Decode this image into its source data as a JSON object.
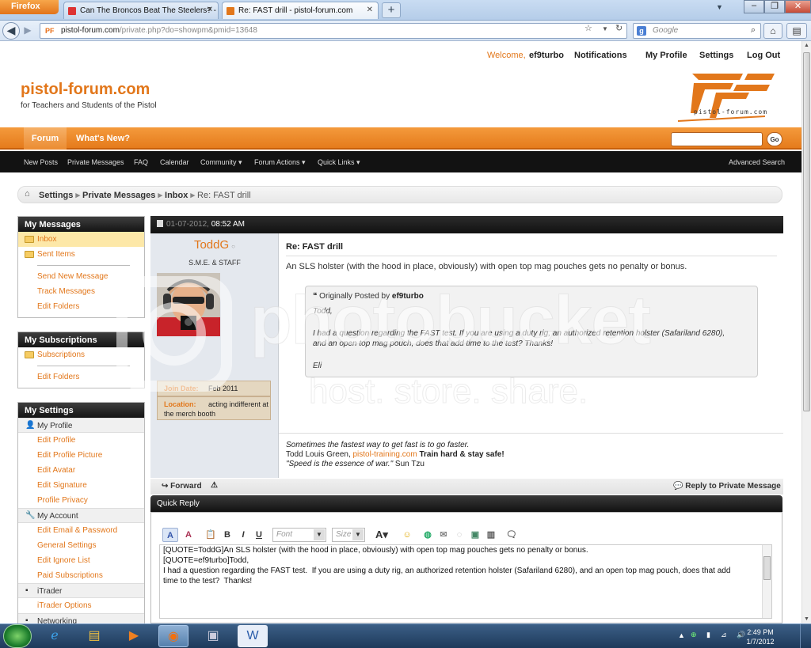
{
  "browser": {
    "app_button": "Firefox",
    "tabs": [
      {
        "label": "Can The Broncos Beat The Steelers? - ..."
      },
      {
        "label": "Re: FAST drill - pistol-forum.com"
      }
    ],
    "new_tab": "+",
    "url_host": "pistol-forum.com",
    "url_path": "/private.php?do=showpm&pmid=13648",
    "search_placeholder": "Google"
  },
  "toplinks": {
    "welcome": "Welcome,",
    "username": "ef9turbo",
    "notifications": "Notifications",
    "my_profile": "My Profile",
    "settings": "Settings",
    "log_out": "Log Out"
  },
  "site": {
    "title": "pistol-forum.com",
    "subtitle": "for Teachers and Students of the Pistol",
    "logo_text": "pistol-forum.com",
    "brand_color": "#e2771b"
  },
  "mainnav": {
    "forum": "Forum",
    "whats_new": "What's New?",
    "go": "Go"
  },
  "subnav": {
    "new_posts": "New Posts",
    "private_messages": "Private Messages",
    "faq": "FAQ",
    "calendar": "Calendar",
    "community": "Community",
    "forum_actions": "Forum Actions",
    "quick_links": "Quick Links",
    "advanced_search": "Advanced Search"
  },
  "breadcrumb": {
    "settings": "Settings",
    "private_messages": "Private Messages",
    "inbox": "Inbox",
    "current": "Re: FAST drill"
  },
  "sidebar": {
    "messages": {
      "title": "My Messages",
      "inbox": "Inbox",
      "sent": "Sent Items",
      "send_new": "Send New Message",
      "track": "Track Messages",
      "edit_folders": "Edit Folders"
    },
    "subscriptions": {
      "title": "My Subscriptions",
      "subscriptions": "Subscriptions",
      "edit_folders": "Edit Folders"
    },
    "settings": {
      "title": "My Settings",
      "my_profile": "My Profile",
      "edit_profile": "Edit Profile",
      "edit_profile_picture": "Edit Profile Picture",
      "edit_avatar": "Edit Avatar",
      "edit_signature": "Edit Signature",
      "profile_privacy": "Profile Privacy",
      "my_account": "My Account",
      "edit_email": "Edit Email & Password",
      "general_settings": "General Settings",
      "edit_ignore": "Edit Ignore List",
      "paid_subscriptions": "Paid Subscriptions",
      "itrader": "iTrader",
      "itrader_options": "iTrader Options",
      "networking": "Networking"
    }
  },
  "post": {
    "date": "01-07-2012,",
    "time": "08:52 AM",
    "author": "ToddG",
    "author_title": "S.M.E. & STAFF",
    "join_label": "Join Date:",
    "join_value": "Feb 2011",
    "location_label": "Location:",
    "location_value_1": "acting indifferent at",
    "location_value_2": "the merch booth",
    "title": "Re: FAST drill",
    "body": "An SLS holster (with the hood in place, obviously) with open top mag pouches gets no penalty or bonus.",
    "quote": {
      "header": "Originally Posted by",
      "author": "ef9turbo",
      "line1": "Todd,",
      "line2": "I had a question regarding the FAST test. If you are using a duty rig, an authorized retention holster (Safariland 6280),",
      "line3": "and an open top mag pouch, does that add time to the test? Thanks!",
      "line4": "Eli"
    },
    "sig1": "Sometimes the fastest way to get fast is to go faster.",
    "sig2a": "Todd Louis Green,",
    "sig2b": "pistol-training.com",
    "sig2c": "Train hard & stay safe!",
    "sig3a": "\"Speed is the essence of war.\"",
    "sig3b": "Sun Tzu"
  },
  "actions": {
    "forward": "Forward",
    "reply": "Reply to Private Message"
  },
  "quick_reply": {
    "title": "Quick Reply",
    "font_placeholder": "Font",
    "size_placeholder": "Size",
    "lines": [
      "[QUOTE=ToddG]An SLS holster (with the hood in place, obviously) with open top mag pouches gets no penalty or bonus.",
      "",
      "[QUOTE=ef9turbo]Todd,",
      "",
      "I had a question regarding the FAST test.  If you are using a duty rig, an authorized retention holster (Safariland 6280), and an open top mag pouch, does that add",
      "time to the test?  Thanks!"
    ]
  },
  "watermark": {
    "line1": "photobucket",
    "line2": "host. store. share."
  },
  "taskbar": {
    "time": "2:49 PM",
    "date": "1/7/2012"
  }
}
